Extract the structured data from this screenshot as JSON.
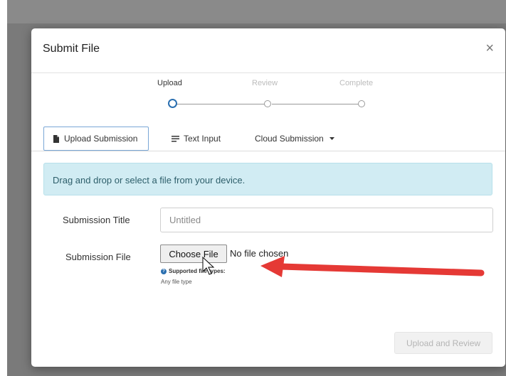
{
  "modal": {
    "title": "Submit File",
    "close_glyph": "×"
  },
  "stepper": {
    "steps": [
      {
        "label": "Upload",
        "state": "active"
      },
      {
        "label": "Review",
        "state": "inactive"
      },
      {
        "label": "Complete",
        "state": "inactive"
      }
    ]
  },
  "tabs": [
    {
      "label": "Upload Submission",
      "icon": "file-icon",
      "active": true
    },
    {
      "label": "Text Input",
      "icon": "text-lines-icon",
      "active": false
    },
    {
      "label": "Cloud Submission",
      "icon": "chevron-down-icon",
      "active": false
    }
  ],
  "alert": {
    "text": "Drag and drop or select a file from your device."
  },
  "form": {
    "title_label": "Submission Title",
    "title_placeholder": "Untitled",
    "file_label": "Submission File",
    "choose_button": "Choose File",
    "no_file_text": "No file chosen",
    "help_title": "Supported file types:",
    "help_detail": "Any file type"
  },
  "footer": {
    "upload_button": "Upload and Review"
  },
  "colors": {
    "accent": "#2a6fb0",
    "alert_bg": "#d1ecf3",
    "annotation_arrow": "#e53935"
  }
}
